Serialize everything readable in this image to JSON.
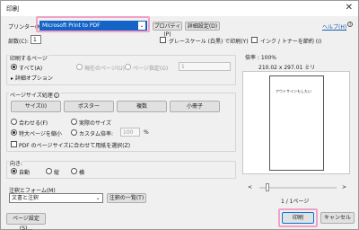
{
  "window": {
    "title": "印刷",
    "close_glyph": "✕"
  },
  "printer": {
    "label": "プリンター(N):",
    "selected": "Microsoft Print to PDF",
    "properties_label": "プロパティ(P)",
    "advanced_label": "詳細設定(D)",
    "help_label": "ヘルプ(H)"
  },
  "copies": {
    "label": "部数(C):",
    "value": "1",
    "grayscale_label": "グレースケール (白黒) で印刷(Y)",
    "save_ink_label": "インク / トナーを節約 (I)"
  },
  "pages": {
    "section_label": "印刷するページ",
    "all_label": "すべて(A)",
    "current_label": "現在のページ(U)",
    "range_label": "ページ指定(G)",
    "range_value": "1",
    "more_options_label": "詳細オプション",
    "selected": "all"
  },
  "page_sizing": {
    "section_label": "ページサイズ処理",
    "buttons": {
      "size": "サイズ(I)",
      "poster": "ポスター",
      "multiple": "複数",
      "booklet": "小冊子"
    },
    "fit_label": "合わせる(F)",
    "actual_label": "実際のサイズ",
    "shrink_label": "特大ページを縮小",
    "custom_label": "カスタム倍率:",
    "custom_value": "100",
    "percent": "%",
    "pdf_size_label": "PDF のページサイズに合わせて用紙を選択(Z)",
    "selected": "shrink"
  },
  "orientation": {
    "section_label": "向き:",
    "auto_label": "自動",
    "portrait_label": "縦",
    "landscape_label": "横",
    "selected": "auto"
  },
  "comments": {
    "section_label": "注釈とフォーム(M)",
    "selected": "文書と注釈",
    "summarize_label": "注釈の一覧(T)"
  },
  "preview": {
    "scale_label": "倍率 : 100%",
    "paper_size": "210.02 x 297.01 ミリ",
    "page_text": "アウトサインもしたい",
    "page_count": "1 / 1ページ",
    "prev_glyph": "<",
    "next_glyph": ">"
  },
  "footer": {
    "page_setup_label": "ページ設定(S)...",
    "print_label": "印刷",
    "cancel_label": "キャンセル"
  },
  "colors": {
    "highlight": "#f2a1c5",
    "printer_select_bg": "#1464c8"
  }
}
